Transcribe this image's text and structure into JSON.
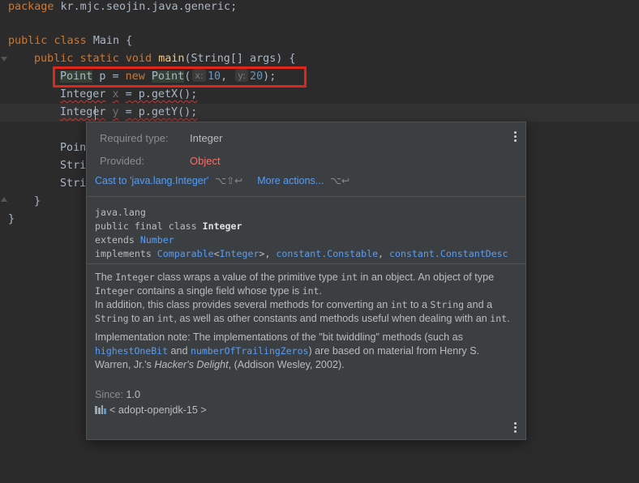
{
  "editor": {
    "lines": {
      "package_kw": "package",
      "package_name": "kr.mjc.seojin.java.generic;",
      "public": "public",
      "class": "class",
      "class_name": "Main",
      "open_brace": "{",
      "static": "static",
      "void": "void",
      "main": "main",
      "main_args": "(String[] args) {",
      "point_type": "Point",
      "p_var": "p",
      "eq": "=",
      "new": "new",
      "point_ctor": "Point",
      "paren_open": "(",
      "hint_x": "x:",
      "val_x": "10",
      "comma": ",",
      "hint_y": "y:",
      "val_y": "20",
      "paren_close": ");",
      "integer1": "Integer",
      "x_var": "x",
      "getx": "= p.getX();",
      "integer2_a": "Integ",
      "integer2_b": "er",
      "y_var": "y",
      "gety": "= p.getY();",
      "partial1": "Poin",
      "partial2": "Stri",
      "partial3": "Stri",
      "close_method": "}",
      "close_class": "}"
    }
  },
  "popup": {
    "required_label": "Required type:",
    "required_value": "Integer",
    "provided_label": "Provided:",
    "provided_value": "Object",
    "cast_action": "Cast to 'java.lang.Integer'",
    "cast_shortcut": "⌥⇧↩",
    "more_actions": "More actions...",
    "more_shortcut": "⌥↩",
    "decl": {
      "package": "java.lang",
      "signature_prefix": "public final class ",
      "signature_name": "Integer",
      "extends_kw": "extends ",
      "extends_link": "Number",
      "implements_kw": "implements ",
      "impl1": "Comparable",
      "impl1_generic": "<Integer>",
      "impl1_generic_link": "Integer",
      "impl_sep": ", ",
      "impl2": "constant.Constable",
      "impl3": "constant.ConstantDesc"
    },
    "doc": {
      "p1_a": "The ",
      "p1_code1": "Integer",
      "p1_b": " class wraps a value of the primitive type ",
      "p1_code2": "int",
      "p1_c": " in an object. An object of type ",
      "p1_code3": "Integer",
      "p1_d": " contains a single field whose type is ",
      "p1_code4": "int",
      "p1_e": ".",
      "p2_a": "In addition, this class provides several methods for converting an ",
      "p2_code1": "int",
      "p2_b": " to a ",
      "p2_code2": "String",
      "p2_c": " and a ",
      "p2_code3": "String",
      "p2_d": " to an ",
      "p2_code4": "int",
      "p2_e": ", as well as other constants and methods useful when dealing with an ",
      "p2_code5": "int",
      "p2_f": ".",
      "p3_a": "Implementation note: The implementations of the \"bit twiddling\" methods (such as ",
      "p3_link1": "highestOneBit",
      "p3_b": " and ",
      "p3_link2": "numberOfTrailingZeros",
      "p3_c": ") are based on material from Henry S. Warren, Jr.'s ",
      "p3_italic": "Hacker's Delight",
      "p3_d": ", (Addison Wesley, 2002)."
    },
    "since_label": "Since:",
    "since_value": "1.0",
    "jdk": "< adopt-openjdk-15 >",
    "jdk_icon": "library-icon",
    "menu_icon": "more-vertical-icon"
  }
}
